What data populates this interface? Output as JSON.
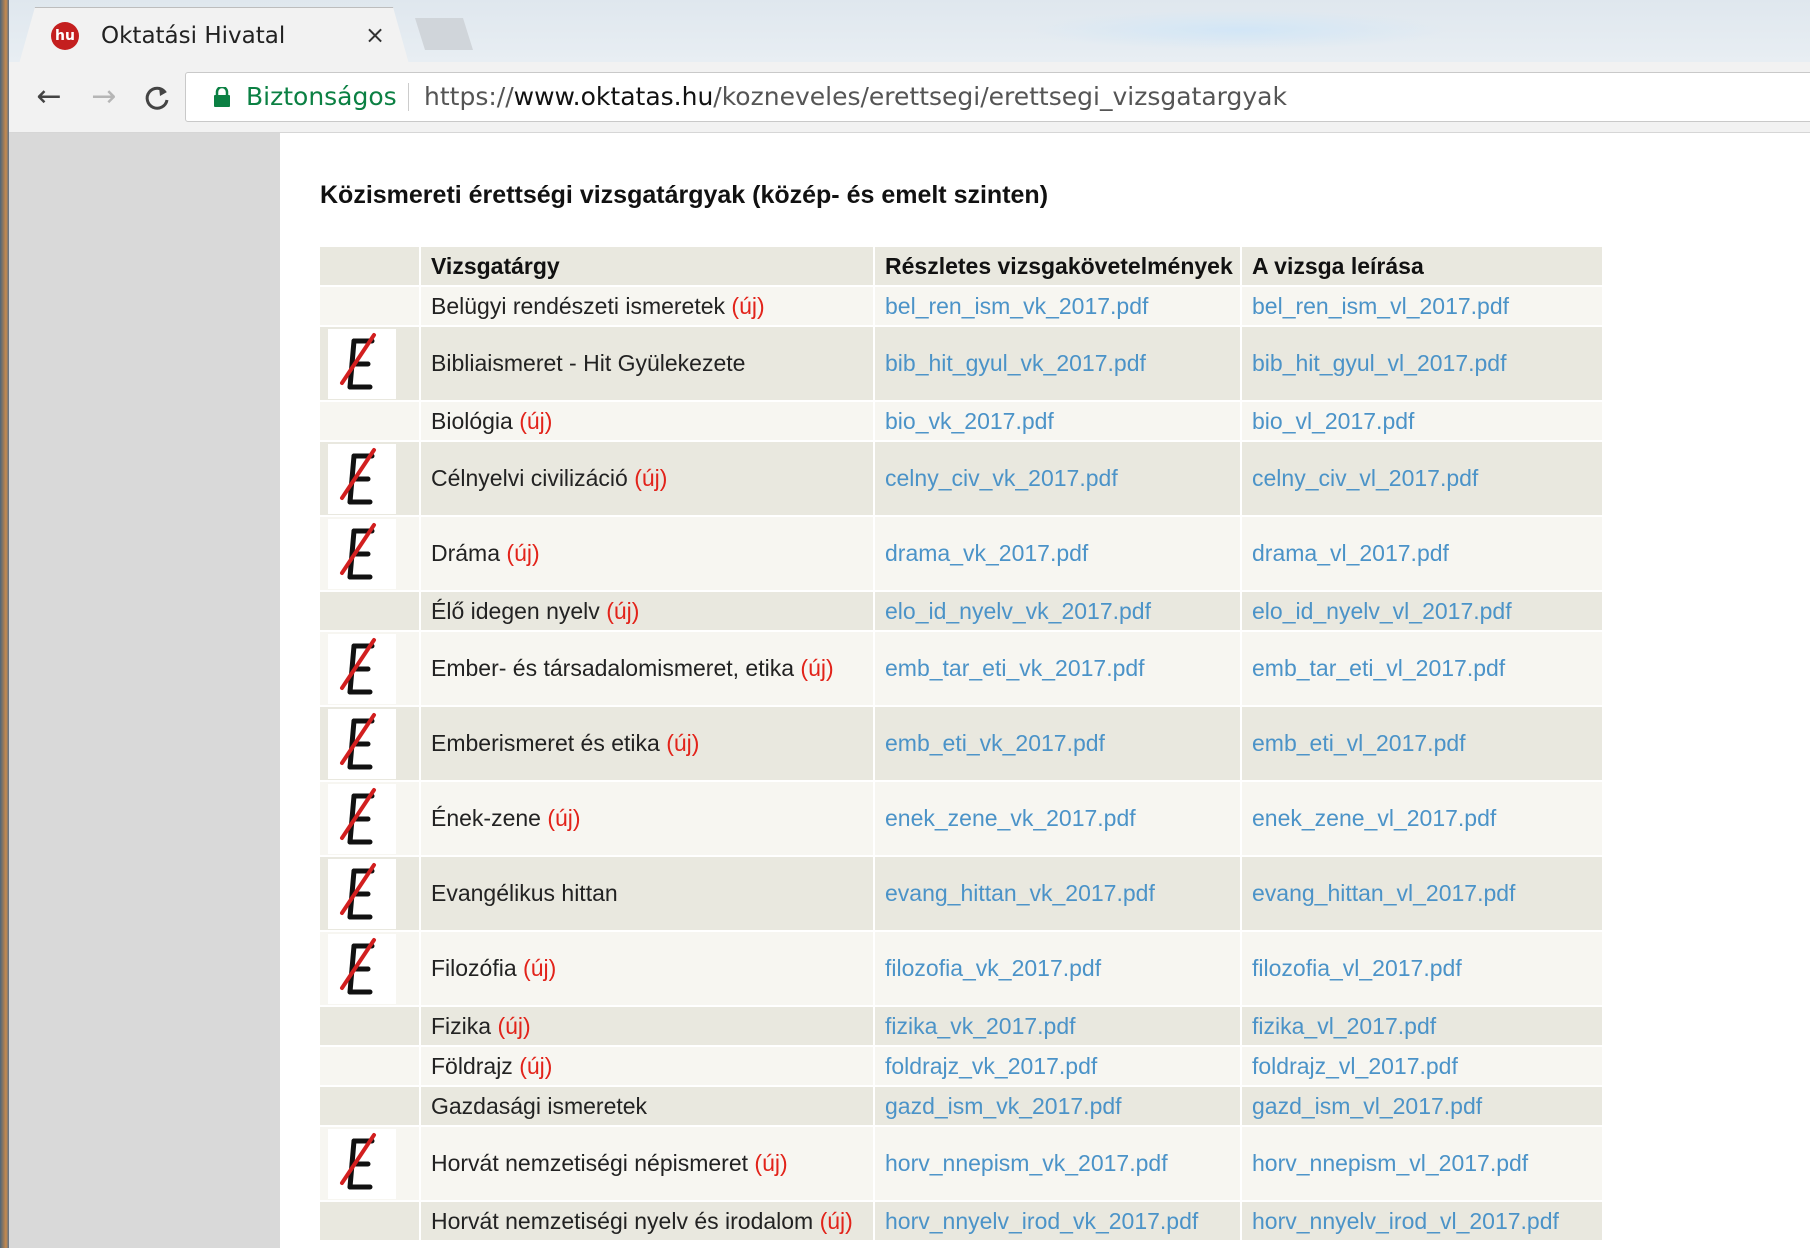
{
  "browser": {
    "tab_title": "Oktatási Hivatal",
    "favicon_text": "hu",
    "close_symbol": "×",
    "secure_label": "Biztonságos",
    "url": {
      "scheme": "https://",
      "domain": "www.oktatas.hu",
      "path": "/kozneveles/erettsegi/erettsegi_vizsgatargyak"
    },
    "icons": {
      "back": "←",
      "forward": "→",
      "reload": "C"
    }
  },
  "page": {
    "title": "Közismereti érettségi vizsgatárgyak (közép- és emelt szinten)",
    "columns": [
      "",
      "Vizsgatárgy",
      "Részletes vizsgakövetelmények",
      "A vizsga leírása"
    ],
    "new_marker": "(új)",
    "rows": [
      {
        "subject": "Belügyi rendészeti ismeretek",
        "new": "(új)",
        "requirements": "bel_ren_ism_vk_2017.pdf",
        "description": "bel_ren_ism_vl_2017.pdf",
        "has_icon": false
      },
      {
        "subject": "Bibliaismeret - Hit Gyülekezete",
        "new": "",
        "requirements": "bib_hit_gyul_vk_2017.pdf",
        "description": "bib_hit_gyul_vl_2017.pdf",
        "has_icon": true
      },
      {
        "subject": "Biológia",
        "new": "(új)",
        "requirements": "bio_vk_2017.pdf",
        "description": "bio_vl_2017.pdf",
        "has_icon": false
      },
      {
        "subject": "Célnyelvi civilizáció",
        "new": "(új)",
        "requirements": "celny_civ_vk_2017.pdf",
        "description": "celny_civ_vl_2017.pdf",
        "has_icon": true
      },
      {
        "subject": "Dráma",
        "new": "(új)",
        "requirements": "drama_vk_2017.pdf",
        "description": "drama_vl_2017.pdf",
        "has_icon": true
      },
      {
        "subject": "Élő idegen nyelv",
        "new": "(új)",
        "requirements": "elo_id_nyelv_vk_2017.pdf",
        "description": "elo_id_nyelv_vl_2017.pdf",
        "has_icon": false
      },
      {
        "subject": "Ember- és társadalomismeret, etika",
        "new": "(új)",
        "requirements": "emb_tar_eti_vk_2017.pdf",
        "description": "emb_tar_eti_vl_2017.pdf",
        "has_icon": true
      },
      {
        "subject": "Emberismeret és etika",
        "new": "(új)",
        "requirements": "emb_eti_vk_2017.pdf",
        "description": "emb_eti_vl_2017.pdf",
        "has_icon": true
      },
      {
        "subject": "Ének-zene",
        "new": "(új)",
        "requirements": "enek_zene_vk_2017.pdf",
        "description": "enek_zene_vl_2017.pdf",
        "has_icon": true
      },
      {
        "subject": "Evangélikus hittan",
        "new": "",
        "requirements": "evang_hittan_vk_2017.pdf",
        "description": "evang_hittan_vl_2017.pdf",
        "has_icon": true
      },
      {
        "subject": "Filozófia",
        "new": "(új)",
        "requirements": "filozofia_vk_2017.pdf",
        "description": "filozofia_vl_2017.pdf",
        "has_icon": true
      },
      {
        "subject": "Fizika",
        "new": "(új)",
        "requirements": "fizika_vk_2017.pdf",
        "description": "fizika_vl_2017.pdf",
        "has_icon": false
      },
      {
        "subject": "Földrajz",
        "new": "(új)",
        "requirements": "foldrajz_vk_2017.pdf",
        "description": "foldrajz_vl_2017.pdf",
        "has_icon": false
      },
      {
        "subject": "Gazdasági ismeretek",
        "new": "",
        "requirements": "gazd_ism_vk_2017.pdf",
        "description": "gazd_ism_vl_2017.pdf",
        "has_icon": false
      },
      {
        "subject": "Horvát nemzetiségi népismeret",
        "new": "(új)",
        "requirements": "horv_nnepism_vk_2017.pdf",
        "description": "horv_nnepism_vl_2017.pdf",
        "has_icon": true
      },
      {
        "subject": "Horvát nemzetiségi nyelv és irodalom",
        "new": "(új)",
        "requirements": "horv_nnyelv_irod_vk_2017.pdf",
        "description": "horv_nnyelv_irod_vl_2017.pdf",
        "has_icon": false
      }
    ]
  },
  "colors": {
    "link": "#4b93c8",
    "new_marker": "#e2231a",
    "secure": "#0b8043",
    "row_light": "#f7f6f1",
    "row_dark": "#e9e8df"
  }
}
